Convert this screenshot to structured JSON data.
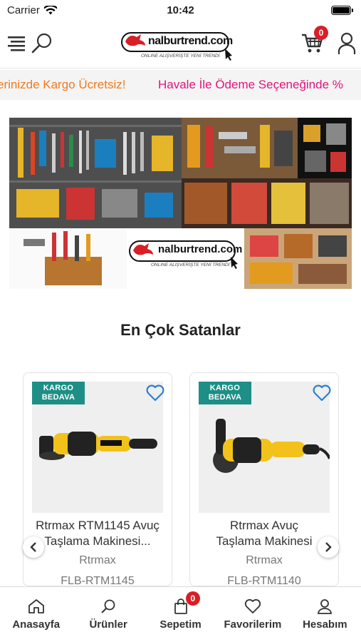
{
  "status_bar": {
    "carrier": "Carrier",
    "time": "10:42"
  },
  "header": {
    "logo_text": "nalburtrend.com",
    "logo_tagline": "ONLINE ALIŞVERİŞTE YENİ TRENDİ",
    "cart_count": "0"
  },
  "marquee": {
    "item1": "erinizde Kargo Ücretsiz!",
    "item2": "Havale İle Ödeme Seçeneğinde %"
  },
  "banner": {
    "logo_text": "nalburtrend.com",
    "logo_tagline": "ONLINE ALIŞVERİŞTE YENİ TRENDİ"
  },
  "section": {
    "title": "En Çok Satanlar"
  },
  "products": [
    {
      "badge": "KARGO\nBEDAVA",
      "badge_l1": "KARGO",
      "badge_l2": "BEDAVA",
      "name_l1": "Rtrmax RTM1145 Avuç",
      "name_l2": "Taşlama Makinesi...",
      "brand": "Rtrmax",
      "code": "FLB-RTM1145"
    },
    {
      "badge": "KARGO\nBEDAVA",
      "badge_l1": "KARGO",
      "badge_l2": "BEDAVA",
      "name_l1": "Rtrmax Avuç",
      "name_l2": "Taşlama Makinesi",
      "brand": "Rtrmax",
      "code": "FLB-RTM1140"
    }
  ],
  "tabbar": {
    "items": [
      {
        "label": "Anasayfa",
        "icon": "home-icon"
      },
      {
        "label": "Ürünler",
        "icon": "search-icon"
      },
      {
        "label": "Sepetim",
        "icon": "bag-icon",
        "badge": "0"
      },
      {
        "label": "Favorilerim",
        "icon": "heart-icon"
      },
      {
        "label": "Hesabım",
        "icon": "user-icon"
      }
    ]
  },
  "colors": {
    "brand_red": "#d81f26",
    "teal": "#1d8f86",
    "orange": "#f07a1c",
    "pink": "#e0147e",
    "heart_blue": "#2d7fd0"
  }
}
